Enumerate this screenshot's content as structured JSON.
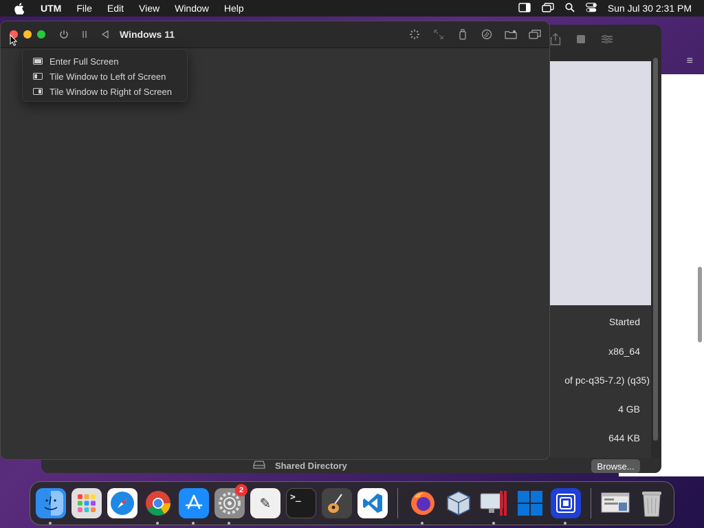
{
  "menubar": {
    "app_name": "UTM",
    "items": [
      "File",
      "Edit",
      "View",
      "Window",
      "Help"
    ],
    "clock": "Sun Jul 30  2:31 PM"
  },
  "vm_window": {
    "title": "Windows 11"
  },
  "popup_menu": {
    "items": [
      "Enter Full Screen",
      "Tile Window to Left of Screen",
      "Tile Window to Right of Screen"
    ]
  },
  "utm_main": {
    "info": [
      "Started",
      "x86_64",
      "of pc-q35-7.2) (q35)",
      "4 GB",
      "644 KB"
    ],
    "shared_directory_label": "Shared Directory",
    "browse_label": "Browse..."
  },
  "dock": {
    "apps": [
      {
        "name": "Finder",
        "icon": "finder-icon",
        "color": "#2d8ef0"
      },
      {
        "name": "Launchpad",
        "icon": "launchpad-icon",
        "color": "#e0e0e0"
      },
      {
        "name": "Safari",
        "icon": "safari-icon",
        "color": "#1e88e5"
      },
      {
        "name": "Chrome",
        "icon": "chrome-icon",
        "color": "#ffffff"
      },
      {
        "name": "App Store",
        "icon": "app-store-icon",
        "color": "#1a8cff"
      },
      {
        "name": "System Settings",
        "icon": "settings-icon",
        "color": "#8a8a8a",
        "badge": "2"
      },
      {
        "name": "TextEdit",
        "icon": "textedit-icon",
        "color": "#f0f0f0"
      },
      {
        "name": "Terminal",
        "icon": "terminal-icon",
        "color": "#1c1c1c"
      },
      {
        "name": "GarageBand",
        "icon": "garageband-icon",
        "color": "#444"
      },
      {
        "name": "VS Code",
        "icon": "vscode-icon",
        "color": "#ffffff"
      },
      {
        "name": "Firefox",
        "icon": "firefox-icon",
        "color": "#3b2a7a"
      },
      {
        "name": "VirtualBox",
        "icon": "virtualbox-icon",
        "color": "#ccd7e6"
      },
      {
        "name": "Parallels",
        "icon": "parallels-icon",
        "color": "#d8e2ec"
      },
      {
        "name": "Windows",
        "icon": "windows-icon",
        "color": "#0a74da"
      },
      {
        "name": "UTM",
        "icon": "utm-icon",
        "color": "#1f3fd6"
      },
      {
        "name": "Virtualization Preview",
        "icon": "preview-window-icon",
        "color": "#e8e8e8"
      },
      {
        "name": "Trash",
        "icon": "trash-icon",
        "color": "#c8c8c8"
      }
    ],
    "terminal_glyph": ">_",
    "textedit_glyph": "✎"
  }
}
